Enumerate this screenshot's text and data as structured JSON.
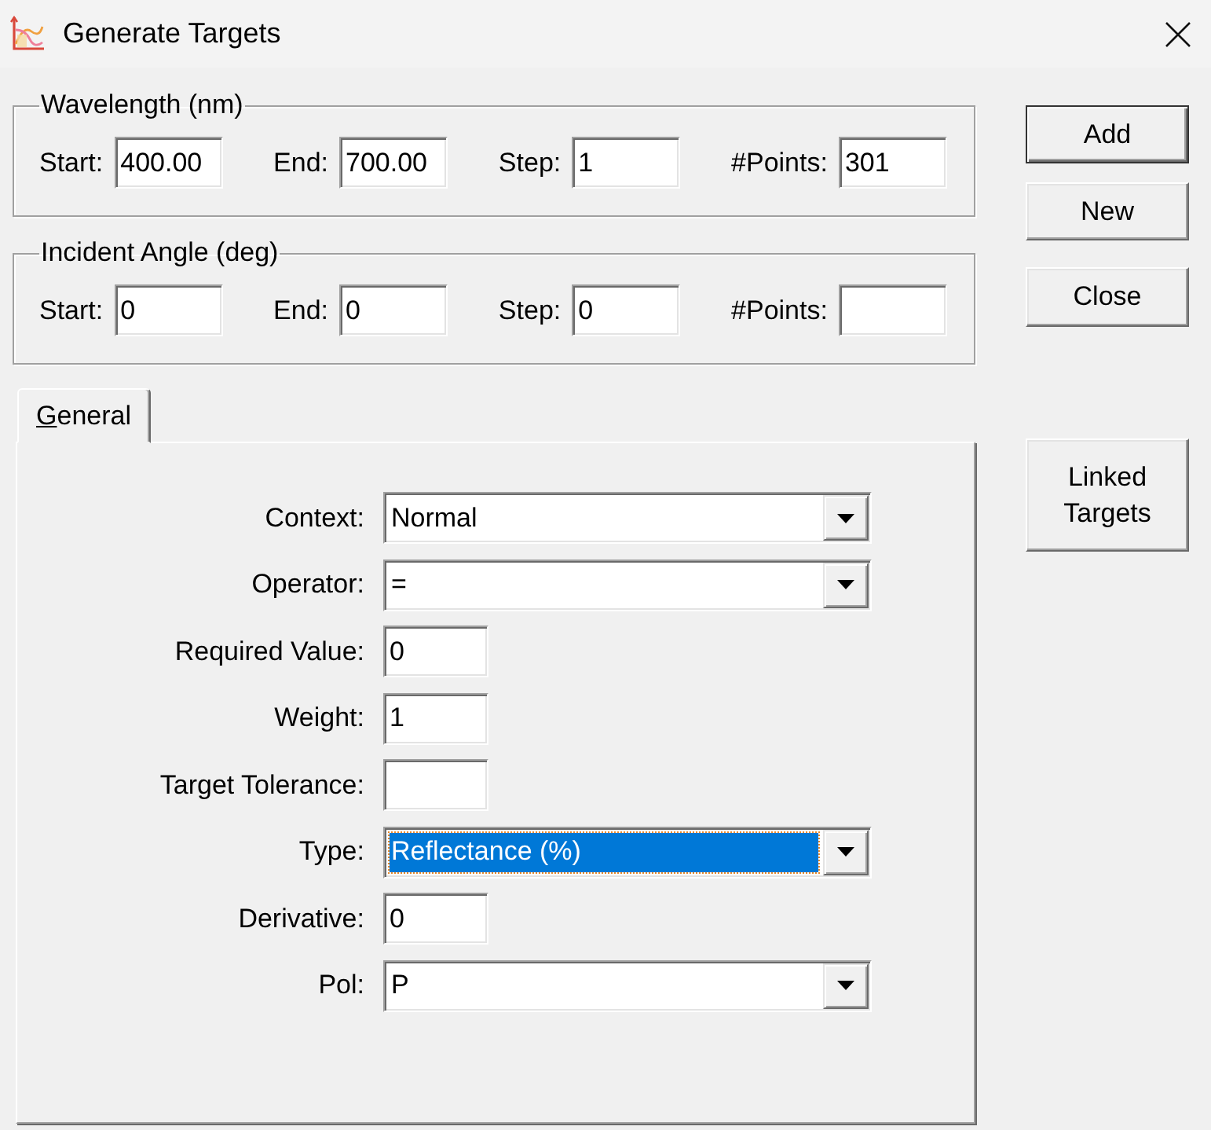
{
  "window": {
    "title": "Generate Targets"
  },
  "groups": [
    {
      "title": "Wavelength (nm)",
      "fields": [
        {
          "label": "Start:",
          "value": "400.00"
        },
        {
          "label": "End:",
          "value": "700.00"
        },
        {
          "label": "Step:",
          "value": "1"
        },
        {
          "label": "#Points:",
          "value": "301"
        }
      ]
    },
    {
      "title": "Incident Angle (deg)",
      "fields": [
        {
          "label": "Start:",
          "value": "0"
        },
        {
          "label": "End:",
          "value": "0"
        },
        {
          "label": "Step:",
          "value": "0"
        },
        {
          "label": "#Points:"
        }
      ]
    }
  ],
  "tabs": [
    {
      "label": "General",
      "selected": true,
      "access_key_underlined": true
    }
  ],
  "form": [
    {
      "kind": "dropdown",
      "label": "Context:",
      "value": "Normal",
      "focused": false
    },
    {
      "kind": "dropdown",
      "label": "Operator:",
      "value": "=",
      "focused": false
    },
    {
      "kind": "text",
      "label": "Required Value:",
      "value": "0",
      "focused": false
    },
    {
      "kind": "text",
      "label": "Weight:",
      "value": "1",
      "focused": false
    },
    {
      "kind": "text",
      "label": "Target Tolerance:",
      "focused": false
    },
    {
      "kind": "dropdown",
      "label": "Type:",
      "value": "Reflectance (%)",
      "focused": true
    },
    {
      "kind": "text",
      "label": "Derivative:",
      "value": "0",
      "focused": false
    },
    {
      "kind": "dropdown",
      "label": "Pol:",
      "value": "P",
      "focused": false
    }
  ],
  "buttons": [
    {
      "label": "Add",
      "default": true
    },
    {
      "label": "New",
      "default": false
    },
    {
      "label": "Close",
      "default": false
    }
  ],
  "side_button": {
    "label": "Linked Targets",
    "default": false
  }
}
